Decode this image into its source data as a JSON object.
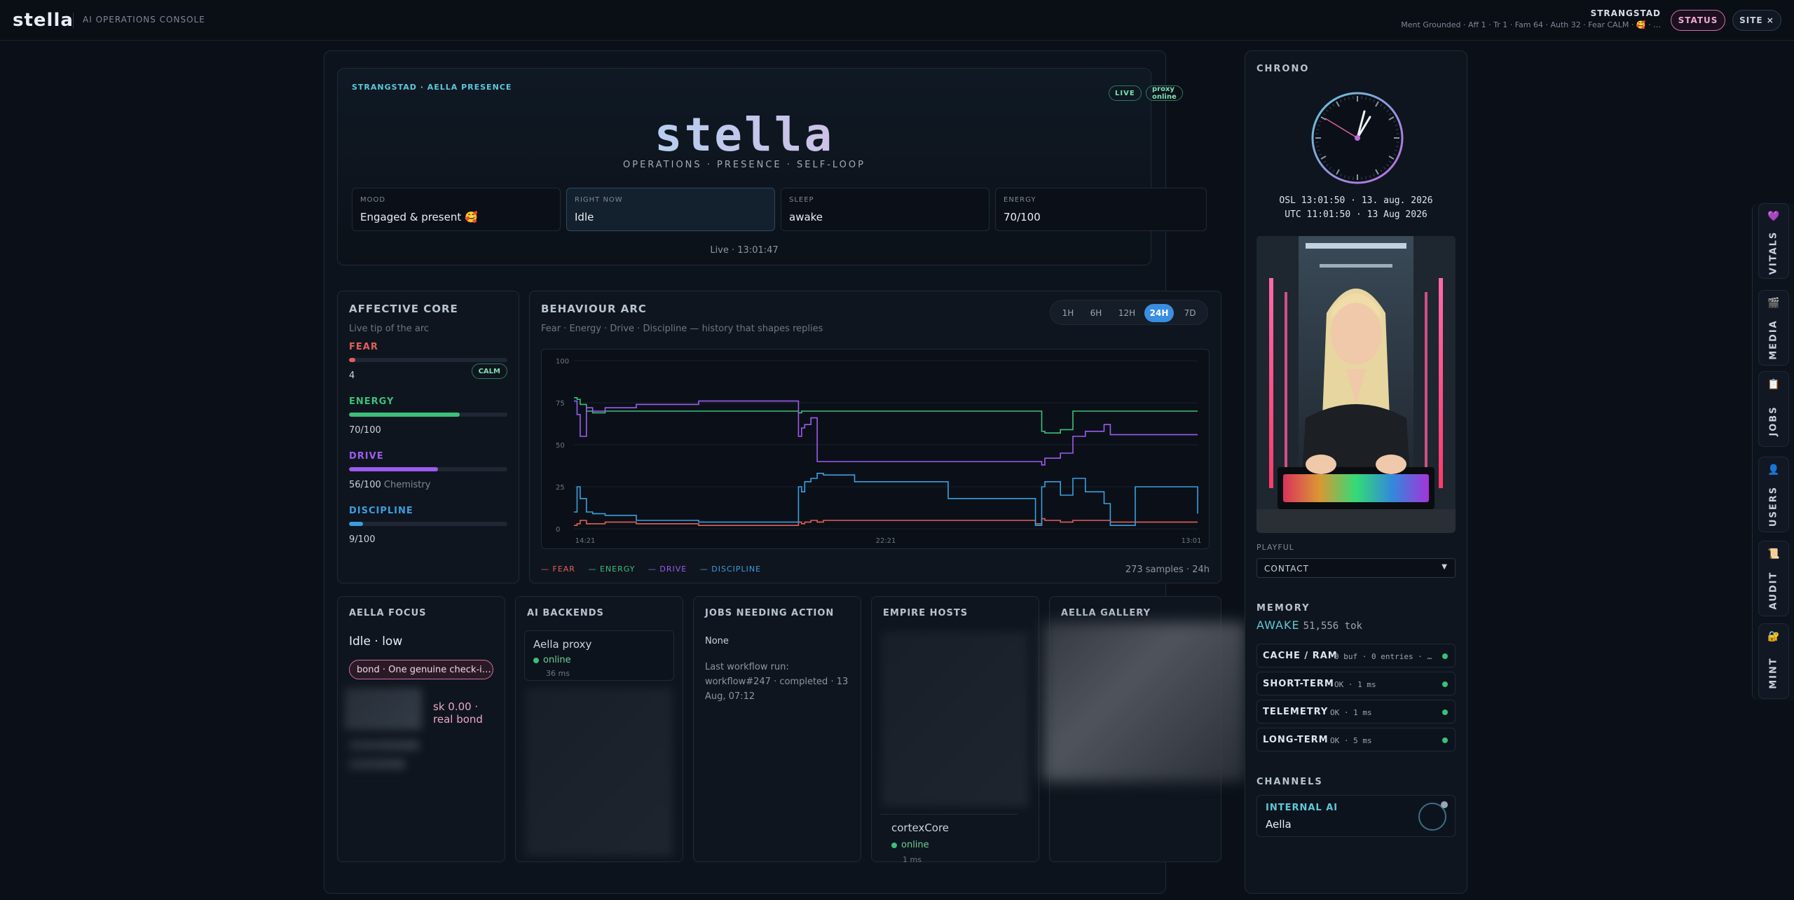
{
  "topbar": {
    "logo": "stella",
    "console_label": "AI OPERATIONS CONSOLE",
    "brand": "STRANGSTAD",
    "summary": "Ment Grounded · Aff 1 · Tr 1 · Fam 64 · Auth 32 · Fear CALM · 🥰 · …",
    "status_label": "STATUS",
    "site_label": "SITE ×"
  },
  "hero": {
    "eyebrow": "STRANGSTAD · AELLA PRESENCE",
    "live_badge": "LIVE",
    "proxy_badge": "proxy online",
    "title_main": "stell",
    "title_accent": "a",
    "subtitle": "OPERATIONS · PRESENCE · SELF-LOOP",
    "cards": [
      {
        "label": "MOOD",
        "value": "Engaged & present 🥰"
      },
      {
        "label": "RIGHT NOW",
        "value": "Idle"
      },
      {
        "label": "SLEEP",
        "value": "awake"
      },
      {
        "label": "ENERGY",
        "value": "70/100"
      }
    ],
    "live_time": "Live · 13:01:47"
  },
  "affective": {
    "title": "AFFECTIVE CORE",
    "hint": "Live tip of the arc",
    "metrics": [
      {
        "name": "FEAR",
        "value": "4",
        "level": 0.04,
        "color": "#e0605a",
        "badge": "CALM"
      },
      {
        "name": "ENERGY",
        "value": "70/100",
        "level": 0.7,
        "color": "#3bbf7a"
      },
      {
        "name": "DRIVE",
        "value": "56/100",
        "extra": "Chemistry",
        "level": 0.56,
        "color": "#9b5cf0"
      },
      {
        "name": "DISCIPLINE",
        "value": "9/100",
        "level": 0.09,
        "color": "#3a9ee0"
      }
    ]
  },
  "arc": {
    "title": "BEHAVIOUR ARC",
    "hint": "Fear · Energy · Drive · Discipline — history that shapes replies",
    "ranges": [
      "1H",
      "6H",
      "12H",
      "24H",
      "7D"
    ],
    "active_range": "24H",
    "legend": [
      "— FEAR",
      "— ENERGY",
      "— DRIVE",
      "— DISCIPLINE"
    ],
    "samples": "273 samples · 24h"
  },
  "chart_data": {
    "type": "line",
    "y_ticks": [
      "100",
      "75",
      "50",
      "25",
      "0"
    ],
    "x_ticks": [
      "14:21",
      "22:21",
      "13:01"
    ],
    "ylim": [
      0,
      100
    ],
    "x": [
      0,
      0.5,
      1,
      2,
      3,
      5,
      10,
      20,
      35,
      36,
      36.5,
      37,
      38,
      39,
      40,
      45,
      60,
      74,
      75,
      75.5,
      78,
      80,
      82,
      85,
      86,
      90,
      100
    ],
    "series": [
      {
        "name": "FEAR",
        "color": "#e0605a",
        "values": [
          2,
          3,
          5,
          3,
          3,
          4,
          3,
          2,
          2,
          4,
          3,
          4,
          5,
          4,
          5,
          5,
          5,
          3,
          6,
          5,
          4,
          5,
          5,
          5,
          4,
          4,
          4
        ]
      },
      {
        "name": "ENERGY",
        "color": "#3bbf7a",
        "values": [
          78,
          77,
          74,
          70,
          69,
          70,
          70,
          70,
          70,
          69,
          70,
          70,
          70,
          70,
          70,
          70,
          70,
          70,
          58,
          57,
          59,
          70,
          70,
          70,
          70,
          70,
          70
        ]
      },
      {
        "name": "DRIVE",
        "color": "#9b5cf0",
        "values": [
          76,
          68,
          55,
          72,
          70,
          72,
          74,
          76,
          76,
          55,
          60,
          62,
          66,
          40,
          40,
          40,
          40,
          40,
          38,
          42,
          45,
          55,
          58,
          62,
          56,
          56,
          56
        ]
      },
      {
        "name": "DISCIPLINE",
        "color": "#3a9ee0",
        "values": [
          10,
          25,
          18,
          10,
          9,
          8,
          5,
          4,
          4,
          25,
          22,
          28,
          30,
          33,
          32,
          28,
          18,
          2,
          25,
          28,
          20,
          30,
          22,
          15,
          2,
          25,
          9
        ]
      }
    ]
  },
  "focus": {
    "title": "AELLA FOCUS",
    "state": "Idle · low",
    "bond": "bond · One genuine check-i…",
    "risk_line1": "sk 0.00 ·",
    "risk_line2": "real bond"
  },
  "backends": {
    "title": "AI BACKENDS",
    "name": "Aella proxy",
    "status": "online",
    "latency": "36 ms"
  },
  "jobs": {
    "title": "JOBS NEEDING ACTION",
    "none": "None",
    "last_run": "Last workflow run: workflow#247 · completed · 13 Aug, 07:12"
  },
  "hosts": {
    "title": "EMPIRE HOSTS",
    "name": "cortexCore",
    "status": "online",
    "latency": "1 ms"
  },
  "gallery": {
    "title": "AELLA GALLERY"
  },
  "side": {
    "chrono_title": "CHRONO",
    "osl": "OSL 13:01:50 · 13. aug. 2026",
    "utc": "UTC 11:01:50 · 13 Aug 2026",
    "playful": "PLAYFUL",
    "contact_option": "CONTACT",
    "memory_title": "MEMORY",
    "awake": "AWAKE",
    "tokens": "51,556 tok",
    "memory_rows": [
      {
        "k": "CACHE / RAM",
        "v": "0 buf · 0 entries · …"
      },
      {
        "k": "SHORT-TERM",
        "v": "OK · 1 ms"
      },
      {
        "k": "TELEMETRY",
        "v": "OK · 1 ms"
      },
      {
        "k": "LONG-TERM",
        "v": "OK · 5 ms"
      }
    ],
    "channels_title": "CHANNELS",
    "channel_label": "INTERNAL AI",
    "channel_name": "Aella"
  },
  "rail": [
    {
      "icon": "💜",
      "label": "VITALS"
    },
    {
      "icon": "🎬",
      "label": "MEDIA"
    },
    {
      "icon": "📋",
      "label": "JOBS"
    },
    {
      "icon": "👤",
      "label": "USERS"
    },
    {
      "icon": "📜",
      "label": "AUDIT"
    },
    {
      "icon": "🔐",
      "label": "MINT"
    }
  ]
}
